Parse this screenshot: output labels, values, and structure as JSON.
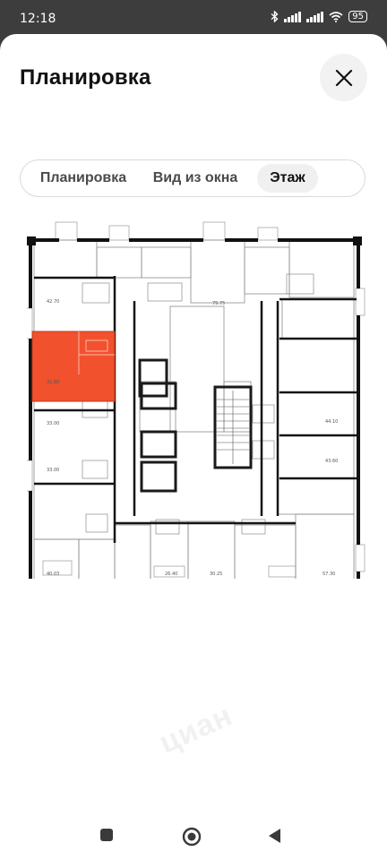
{
  "status_bar": {
    "time": "12:18",
    "battery": "95"
  },
  "header": {
    "title": "Планировка"
  },
  "tabs": [
    {
      "label": "Планировка",
      "active": false
    },
    {
      "label": "Вид из окна",
      "active": false
    },
    {
      "label": "Этаж",
      "active": true
    }
  ],
  "floor_plan": {
    "highlight_color": "#f2512d",
    "selected_unit_area": "32.80",
    "unit_areas": [
      "42.70",
      "79.75",
      "33.00",
      "33.00",
      "44.10",
      "43.60",
      "40.03",
      "26.40",
      "30.25",
      "57.30"
    ]
  },
  "watermark": {
    "text": "циан"
  },
  "colors": {
    "accent": "#f2512d",
    "text": "#121212",
    "tab_active_bg": "#f0f0f0"
  }
}
